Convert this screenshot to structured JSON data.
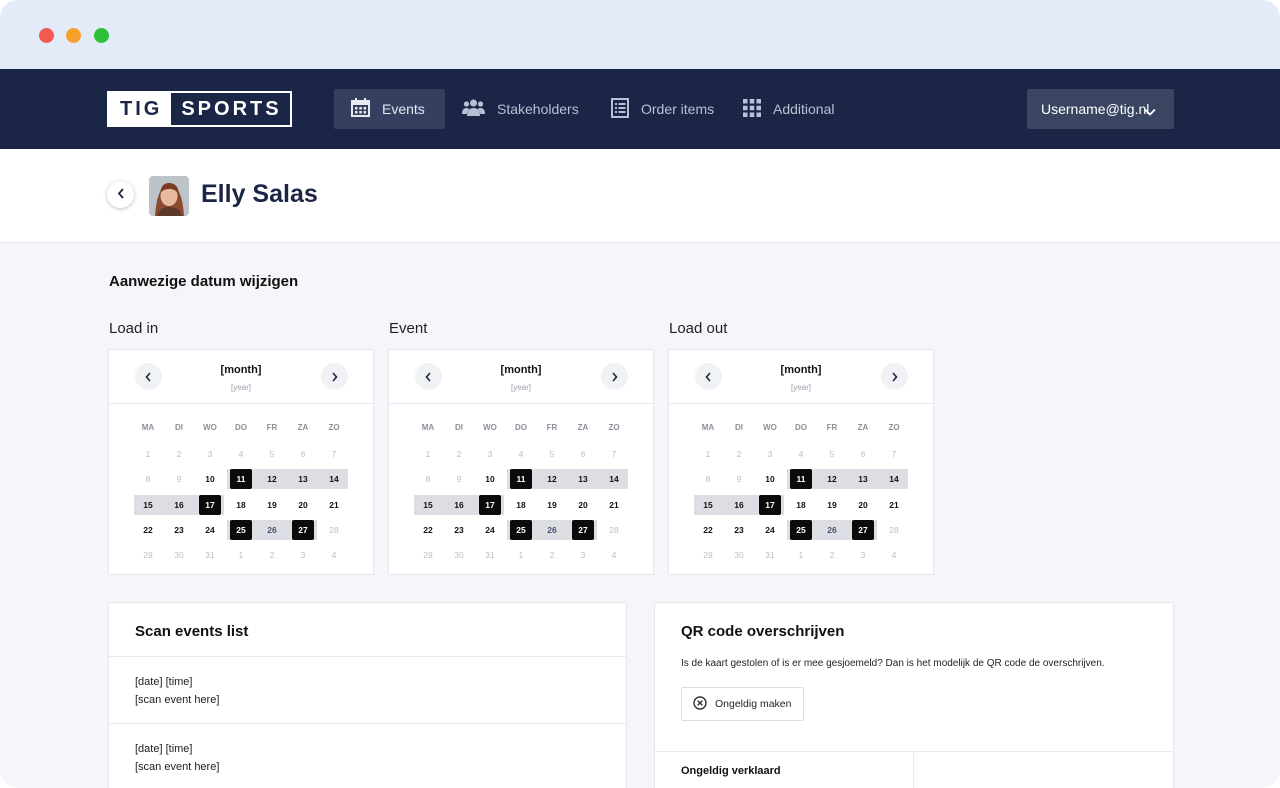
{
  "window": {
    "controls": [
      "close",
      "minimize",
      "maximize"
    ]
  },
  "brand": {
    "part1": "TIG",
    "part2": "SPORTS"
  },
  "nav": {
    "items": [
      {
        "label": "Events",
        "icon": "calendar-icon",
        "active": true
      },
      {
        "label": "Stakeholders",
        "icon": "users-icon",
        "active": false
      },
      {
        "label": "Order items",
        "icon": "list-icon",
        "active": false
      },
      {
        "label": "Additional",
        "icon": "grid-icon",
        "active": false
      }
    ],
    "user": "Username@tig.nl"
  },
  "person": {
    "name": "Elly Salas"
  },
  "section": {
    "title": "Aanwezige datum wijzigen"
  },
  "calendars": [
    {
      "label": "Load in",
      "month": "[month]",
      "year": "[year]"
    },
    {
      "label": "Event",
      "month": "[month]",
      "year": "[year]"
    },
    {
      "label": "Load out",
      "month": "[month]",
      "year": "[year]"
    }
  ],
  "calendar_common": {
    "weekdays": [
      "MA",
      "DI",
      "WO",
      "DO",
      "FR",
      "ZA",
      "ZO"
    ],
    "weeks": [
      [
        "1",
        "2",
        "3",
        "4",
        "5",
        "6",
        "7"
      ],
      [
        "8",
        "9",
        "10",
        "11",
        "12",
        "13",
        "14"
      ],
      [
        "15",
        "16",
        "17",
        "18",
        "19",
        "20",
        "21"
      ],
      [
        "22",
        "23",
        "24",
        "25",
        "26",
        "27",
        "28"
      ],
      [
        "29",
        "30",
        "31",
        "1",
        "2",
        "3",
        "4"
      ]
    ],
    "muted_days": [
      "1",
      "2",
      "3",
      "4",
      "5",
      "6",
      "7",
      "8",
      "9",
      "28",
      "29",
      "30",
      "31"
    ],
    "selected_days": [
      "11",
      "17",
      "25",
      "27"
    ],
    "range_days": [
      "11",
      "12",
      "13",
      "14",
      "15",
      "16",
      "17",
      "25",
      "26",
      "27"
    ]
  },
  "scan_events": {
    "title": "Scan events list",
    "items": [
      {
        "datetime": "[date] [time]",
        "event": "[scan event here]"
      },
      {
        "datetime": "[date] [time]",
        "event": "[scan event here]"
      }
    ]
  },
  "qr": {
    "title": "QR code overschrijven",
    "description": "Is de kaart gestolen of is er mee gesjoemeld? Dan is het modelijk de QR code de overschrijven.",
    "button": "Ongeldig maken",
    "invalid_label": "Ongeldig verklaard"
  },
  "colors": {
    "navbar": "#1b2545",
    "accent_active": "#35405e",
    "selected_day": "#0b0b0b",
    "range": "#dcdee3"
  }
}
